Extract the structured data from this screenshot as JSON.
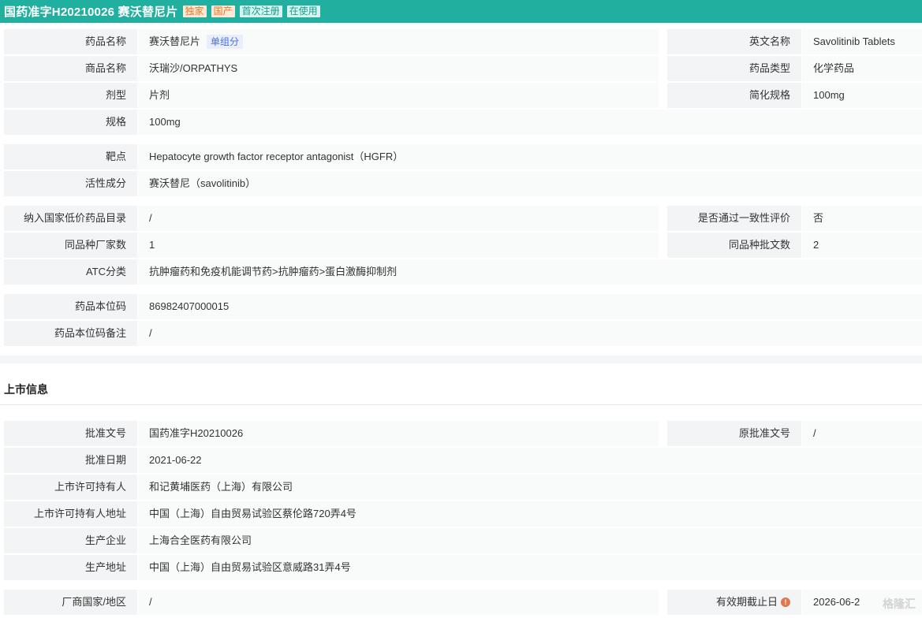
{
  "header": {
    "title": "国药准字H20210026  赛沃替尼片",
    "badges": [
      "独家",
      "国产",
      "首次注册",
      "在使用"
    ]
  },
  "basic": {
    "drug_name_label": "药品名称",
    "drug_name_value": "赛沃替尼片",
    "drug_name_tag": "单组分",
    "en_name_label": "英文名称",
    "en_name_value": "Savolitinib Tablets",
    "trade_name_label": "商品名称",
    "trade_name_value": "沃瑞沙/ORPATHYS",
    "drug_type_label": "药品类型",
    "drug_type_value": "化学药品",
    "dosage_form_label": "剂型",
    "dosage_form_value": "片剂",
    "simple_spec_label": "简化规格",
    "simple_spec_value": "100mg",
    "spec_label": "规格",
    "spec_value": "100mg"
  },
  "target": {
    "target_label": "靶点",
    "target_value": "Hepatocyte growth factor receptor antagonist（HGFR）",
    "active_label": "活性成分",
    "active_value": "赛沃替尼（savolitinib）"
  },
  "catalog": {
    "lowprice_label": "纳入国家低价药品目录",
    "lowprice_value": "/",
    "consistency_label": "是否通过一致性评价",
    "consistency_value": "否",
    "mfr_count_label": "同品种厂家数",
    "mfr_count_value": "1",
    "approval_count_label": "同品种批文数",
    "approval_count_value": "2",
    "atc_label": "ATC分类",
    "atc_value": "抗肿瘤药和免疫机能调节药>抗肿瘤药>蛋白激酶抑制剂"
  },
  "code": {
    "code_label": "药品本位码",
    "code_value": "86982407000015",
    "code_note_label": "药品本位码备注",
    "code_note_value": "/"
  },
  "listing": {
    "section_title": "上市信息",
    "approval_no_label": "批准文号",
    "approval_no_value": "国药准字H20210026",
    "orig_approval_label": "原批准文号",
    "orig_approval_value": "/",
    "approval_date_label": "批准日期",
    "approval_date_value": "2021-06-22",
    "holder_label": "上市许可持有人",
    "holder_value": "和记黄埔医药（上海）有限公司",
    "holder_addr_label": "上市许可持有人地址",
    "holder_addr_value": "中国（上海）自由贸易试验区蔡伦路720弄4号",
    "producer_label": "生产企业",
    "producer_value": "上海合全医药有限公司",
    "producer_addr_label": "生产地址",
    "producer_addr_value": "中国（上海）自由贸易试验区意威路31弄4号",
    "country_label": "厂商国家/地区",
    "country_value": "/",
    "expiry_label": "有效期截止日",
    "expiry_value": "2026-06-2"
  },
  "watermark": "格隆汇"
}
